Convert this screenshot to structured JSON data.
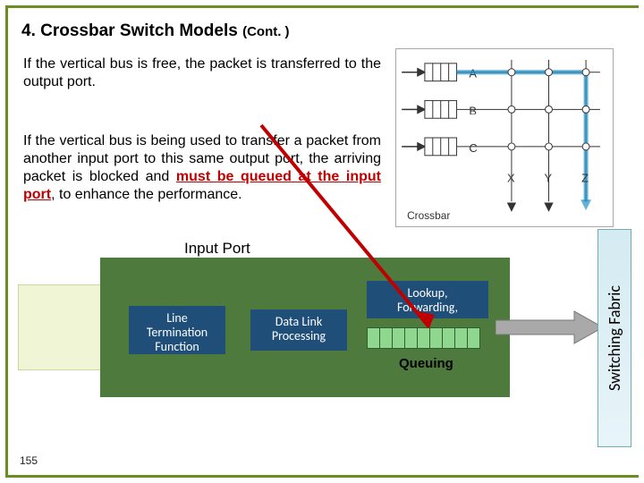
{
  "title_main": "4. Crossbar Switch Models",
  "title_cont": "(Cont. )",
  "para1": "If the vertical bus is free, the packet is transferred to the output port.",
  "para2_a": "If the vertical bus is being used to transfer a packet from another input port to this same output port, the arriving packet is blocked and ",
  "para2_red": "must be queued at the input port",
  "para2_b": ", to enhance the performance.",
  "input_port_label": "Input Port",
  "modules": {
    "line_term": "Line\nTermination\nFunction",
    "data_link": "Data Link\nProcessing",
    "lookup": "Lookup,\nForwarding,"
  },
  "queuing_label": "Queuing",
  "switching_fabric": "Switching Fabric",
  "crossbar": {
    "label": "Crossbar",
    "rows": [
      "A",
      "B",
      "C"
    ],
    "cols": [
      "X",
      "Y",
      "Z"
    ]
  },
  "page_num": "155",
  "colors": {
    "accent_green": "#6b8e23",
    "module_blue": "#1f4e79",
    "panel_green": "#4e7a3e",
    "red": "#c00000"
  }
}
